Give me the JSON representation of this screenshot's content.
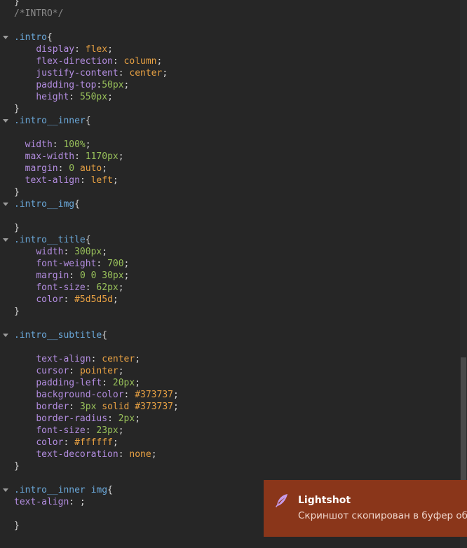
{
  "editor": {
    "lines": [
      [
        {
          "t": "punc",
          "v": "}"
        }
      ],
      [
        {
          "t": "comment",
          "v": "/*INTRO*/"
        }
      ],
      [],
      [
        {
          "t": "sel",
          "v": ".intro"
        },
        {
          "t": "punc",
          "v": "{"
        }
      ],
      [
        {
          "t": "punc",
          "v": "    "
        },
        {
          "t": "prop",
          "v": "display"
        },
        {
          "t": "punc",
          "v": ": "
        },
        {
          "t": "val",
          "v": "flex"
        },
        {
          "t": "punc",
          "v": ";"
        }
      ],
      [
        {
          "t": "punc",
          "v": "    "
        },
        {
          "t": "prop",
          "v": "flex-direction"
        },
        {
          "t": "punc",
          "v": ": "
        },
        {
          "t": "val",
          "v": "column"
        },
        {
          "t": "punc",
          "v": ";"
        }
      ],
      [
        {
          "t": "punc",
          "v": "    "
        },
        {
          "t": "prop",
          "v": "justify-content"
        },
        {
          "t": "punc",
          "v": ": "
        },
        {
          "t": "val",
          "v": "center"
        },
        {
          "t": "punc",
          "v": ";"
        }
      ],
      [
        {
          "t": "punc",
          "v": "    "
        },
        {
          "t": "prop",
          "v": "padding-top"
        },
        {
          "t": "punc",
          "v": ":"
        },
        {
          "t": "num",
          "v": "50px"
        },
        {
          "t": "punc",
          "v": ";"
        }
      ],
      [
        {
          "t": "punc",
          "v": "    "
        },
        {
          "t": "prop",
          "v": "height"
        },
        {
          "t": "punc",
          "v": ": "
        },
        {
          "t": "num",
          "v": "550px"
        },
        {
          "t": "punc",
          "v": ";"
        }
      ],
      [
        {
          "t": "punc",
          "v": "}"
        }
      ],
      [
        {
          "t": "sel",
          "v": ".intro__inner"
        },
        {
          "t": "punc",
          "v": "{"
        }
      ],
      [],
      [
        {
          "t": "punc",
          "v": "  "
        },
        {
          "t": "prop",
          "v": "width"
        },
        {
          "t": "punc",
          "v": ": "
        },
        {
          "t": "num",
          "v": "100%"
        },
        {
          "t": "punc",
          "v": ";"
        }
      ],
      [
        {
          "t": "punc",
          "v": "  "
        },
        {
          "t": "prop",
          "v": "max-width"
        },
        {
          "t": "punc",
          "v": ": "
        },
        {
          "t": "num",
          "v": "1170px"
        },
        {
          "t": "punc",
          "v": ";"
        }
      ],
      [
        {
          "t": "punc",
          "v": "  "
        },
        {
          "t": "prop",
          "v": "margin"
        },
        {
          "t": "punc",
          "v": ": "
        },
        {
          "t": "num",
          "v": "0"
        },
        {
          "t": "punc",
          "v": " "
        },
        {
          "t": "val",
          "v": "auto"
        },
        {
          "t": "punc",
          "v": ";"
        }
      ],
      [
        {
          "t": "punc",
          "v": "  "
        },
        {
          "t": "prop",
          "v": "text-align"
        },
        {
          "t": "punc",
          "v": ": "
        },
        {
          "t": "val",
          "v": "left"
        },
        {
          "t": "punc",
          "v": ";"
        }
      ],
      [
        {
          "t": "punc",
          "v": "}"
        }
      ],
      [
        {
          "t": "sel",
          "v": ".intro__img"
        },
        {
          "t": "punc",
          "v": "{"
        }
      ],
      [],
      [
        {
          "t": "punc",
          "v": "}"
        }
      ],
      [
        {
          "t": "sel",
          "v": ".intro__title"
        },
        {
          "t": "punc",
          "v": "{"
        }
      ],
      [
        {
          "t": "punc",
          "v": "    "
        },
        {
          "t": "prop",
          "v": "width"
        },
        {
          "t": "punc",
          "v": ": "
        },
        {
          "t": "num",
          "v": "300px"
        },
        {
          "t": "punc",
          "v": ";"
        }
      ],
      [
        {
          "t": "punc",
          "v": "    "
        },
        {
          "t": "prop",
          "v": "font-weight"
        },
        {
          "t": "punc",
          "v": ": "
        },
        {
          "t": "num",
          "v": "700"
        },
        {
          "t": "punc",
          "v": ";"
        }
      ],
      [
        {
          "t": "punc",
          "v": "    "
        },
        {
          "t": "prop",
          "v": "margin"
        },
        {
          "t": "punc",
          "v": ": "
        },
        {
          "t": "num",
          "v": "0 0 30px"
        },
        {
          "t": "punc",
          "v": ";"
        }
      ],
      [
        {
          "t": "punc",
          "v": "    "
        },
        {
          "t": "prop",
          "v": "font-size"
        },
        {
          "t": "punc",
          "v": ": "
        },
        {
          "t": "num",
          "v": "62px"
        },
        {
          "t": "punc",
          "v": ";"
        }
      ],
      [
        {
          "t": "punc",
          "v": "    "
        },
        {
          "t": "prop",
          "v": "color"
        },
        {
          "t": "punc",
          "v": ": "
        },
        {
          "t": "val",
          "v": "#5d5d5d"
        },
        {
          "t": "punc",
          "v": ";"
        }
      ],
      [
        {
          "t": "punc",
          "v": "}"
        }
      ],
      [],
      [
        {
          "t": "sel",
          "v": ".intro__subtitle"
        },
        {
          "t": "punc",
          "v": "{"
        }
      ],
      [],
      [
        {
          "t": "punc",
          "v": "    "
        },
        {
          "t": "prop",
          "v": "text-align"
        },
        {
          "t": "punc",
          "v": ": "
        },
        {
          "t": "val",
          "v": "center"
        },
        {
          "t": "punc",
          "v": ";"
        }
      ],
      [
        {
          "t": "punc",
          "v": "    "
        },
        {
          "t": "prop",
          "v": "cursor"
        },
        {
          "t": "punc",
          "v": ": "
        },
        {
          "t": "val",
          "v": "pointer"
        },
        {
          "t": "punc",
          "v": ";"
        }
      ],
      [
        {
          "t": "punc",
          "v": "    "
        },
        {
          "t": "prop",
          "v": "padding-left"
        },
        {
          "t": "punc",
          "v": ": "
        },
        {
          "t": "num",
          "v": "20px"
        },
        {
          "t": "punc",
          "v": ";"
        }
      ],
      [
        {
          "t": "punc",
          "v": "    "
        },
        {
          "t": "prop",
          "v": "background-color"
        },
        {
          "t": "punc",
          "v": ": "
        },
        {
          "t": "val",
          "v": "#373737"
        },
        {
          "t": "punc",
          "v": ";"
        }
      ],
      [
        {
          "t": "punc",
          "v": "    "
        },
        {
          "t": "prop",
          "v": "border"
        },
        {
          "t": "punc",
          "v": ": "
        },
        {
          "t": "num",
          "v": "3px"
        },
        {
          "t": "punc",
          "v": " "
        },
        {
          "t": "val",
          "v": "solid #373737"
        },
        {
          "t": "punc",
          "v": ";"
        }
      ],
      [
        {
          "t": "punc",
          "v": "    "
        },
        {
          "t": "prop",
          "v": "border-radius"
        },
        {
          "t": "punc",
          "v": ": "
        },
        {
          "t": "num",
          "v": "2px"
        },
        {
          "t": "punc",
          "v": ";"
        }
      ],
      [
        {
          "t": "punc",
          "v": "    "
        },
        {
          "t": "prop",
          "v": "font-size"
        },
        {
          "t": "punc",
          "v": ": "
        },
        {
          "t": "num",
          "v": "23px"
        },
        {
          "t": "punc",
          "v": ";"
        }
      ],
      [
        {
          "t": "punc",
          "v": "    "
        },
        {
          "t": "prop",
          "v": "color"
        },
        {
          "t": "punc",
          "v": ": "
        },
        {
          "t": "val",
          "v": "#ffffff"
        },
        {
          "t": "punc",
          "v": ";"
        }
      ],
      [
        {
          "t": "punc",
          "v": "    "
        },
        {
          "t": "prop",
          "v": "text-decoration"
        },
        {
          "t": "punc",
          "v": ": "
        },
        {
          "t": "val",
          "v": "none"
        },
        {
          "t": "punc",
          "v": ";"
        }
      ],
      [
        {
          "t": "punc",
          "v": "}"
        }
      ],
      [],
      [
        {
          "t": "sel",
          "v": ".intro__inner img"
        },
        {
          "t": "punc",
          "v": "{"
        }
      ],
      [
        {
          "t": "prop",
          "v": "text-align"
        },
        {
          "t": "punc",
          "v": ": ;"
        }
      ],
      [],
      [
        {
          "t": "punc",
          "v": "}"
        }
      ]
    ],
    "fold_lines": [
      3,
      10,
      17,
      20,
      28,
      41
    ]
  },
  "toast": {
    "app_name": "Lightshot",
    "message": "Скриншот скопирован в буфер обмена",
    "icon": "feather-icon"
  }
}
